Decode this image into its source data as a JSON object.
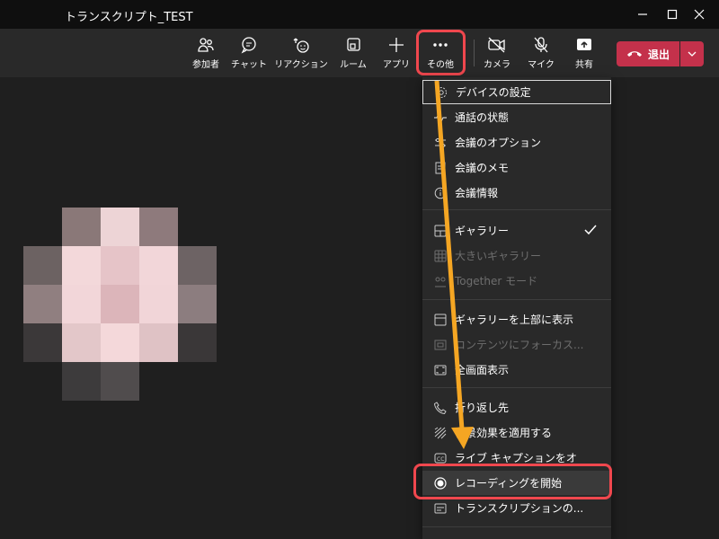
{
  "window": {
    "title": "トランスクリプト_TEST"
  },
  "toolbar": {
    "items": [
      {
        "label": "参加者",
        "icon": "people-icon"
      },
      {
        "label": "チャット",
        "icon": "chat-icon"
      },
      {
        "label": "リアクション",
        "icon": "reaction-icon"
      },
      {
        "label": "ルーム",
        "icon": "rooms-icon"
      },
      {
        "label": "アプリ",
        "icon": "plus-icon"
      },
      {
        "label": "その他",
        "icon": "more-icon"
      },
      {
        "label": "カメラ",
        "icon": "camera-off-icon"
      },
      {
        "label": "マイク",
        "icon": "mic-off-icon"
      },
      {
        "label": "共有",
        "icon": "share-icon"
      }
    ],
    "leave_label": "退出"
  },
  "menu": {
    "items": [
      {
        "label": "デバイスの設定",
        "icon": "gear-icon",
        "enabled": true
      },
      {
        "label": "通話の状態",
        "icon": "pulse-icon",
        "enabled": true
      },
      {
        "label": "会議のオプション",
        "icon": "options-icon",
        "enabled": true
      },
      {
        "label": "会議のメモ",
        "icon": "notes-icon",
        "enabled": true
      },
      {
        "label": "会議情報",
        "icon": "info-icon",
        "enabled": true
      },
      {
        "label": "ギャラリー",
        "icon": "gallery-icon",
        "enabled": true,
        "checked": true
      },
      {
        "label": "大きいギャラリー",
        "icon": "large-gallery-icon",
        "enabled": false
      },
      {
        "label": "Together モード",
        "icon": "together-icon",
        "enabled": false
      },
      {
        "label": "ギャラリーを上部に表示",
        "icon": "gallery-top-icon",
        "enabled": true
      },
      {
        "label": "コンテンツにフォーカス...",
        "icon": "focus-icon",
        "enabled": false
      },
      {
        "label": "全画面表示",
        "icon": "fullscreen-icon",
        "enabled": true
      },
      {
        "label": "折り返し先",
        "icon": "phone-icon",
        "enabled": true
      },
      {
        "label": "背景効果を適用する",
        "icon": "background-icon",
        "enabled": true
      },
      {
        "label": "ライブ キャプションをオ",
        "icon": "cc-icon",
        "enabled": true
      },
      {
        "label": "レコーディングを開始",
        "icon": "record-icon",
        "enabled": true,
        "highlighted": true
      },
      {
        "label": "トランスクリプションの...",
        "icon": "transcript-icon",
        "enabled": true
      }
    ]
  },
  "colors": {
    "accent_highlight": "#f0474e",
    "annotation_arrow": "#f5a623",
    "leave_button": "#c4314b"
  }
}
